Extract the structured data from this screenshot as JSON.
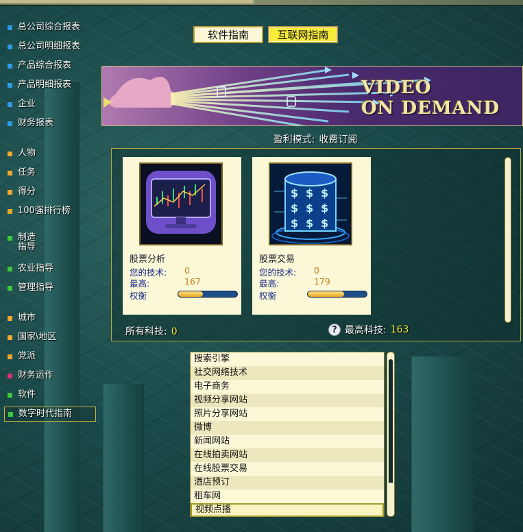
{
  "sidebar": {
    "items": [
      {
        "label": "总公司综合报表",
        "color": "#2e9be6"
      },
      {
        "label": "总公司明细报表",
        "color": "#2e9be6"
      },
      {
        "label": "产品综合报表",
        "color": "#2e9be6"
      },
      {
        "label": "产品明细报表",
        "color": "#2e9be6"
      },
      {
        "label": "企业",
        "color": "#2e9be6"
      },
      {
        "label": "财务报表",
        "color": "#2e9be6"
      },
      {
        "label": "人物",
        "color": "#f0a830"
      },
      {
        "label": "任务",
        "color": "#f0a830"
      },
      {
        "label": "得分",
        "color": "#f0a830"
      },
      {
        "label": "100强排行榜",
        "color": "#f0a830"
      },
      {
        "label": "制造\n指导",
        "color": "#3cc83c"
      },
      {
        "label": "农业指导",
        "color": "#3cc83c"
      },
      {
        "label": "管理指导",
        "color": "#3cc83c"
      },
      {
        "label": "城市",
        "color": "#f0a830"
      },
      {
        "label": "国家\\地区",
        "color": "#f0a830"
      },
      {
        "label": "党派",
        "color": "#f0a830"
      },
      {
        "label": "财务运作",
        "color": "#e0306a"
      },
      {
        "label": "软件",
        "color": "#3cc83c"
      },
      {
        "label": "数字时代指南",
        "color": "#3cc83c",
        "selected": true
      }
    ]
  },
  "guide_buttons": {
    "software": "软件指南",
    "internet": "互联网指南"
  },
  "banner": {
    "line1": "VIDEO",
    "line2": "ON DEMAND"
  },
  "profit_mode": {
    "label": "盈利模式:",
    "value": "收费订阅"
  },
  "tech_cards": [
    {
      "name": "股票分析",
      "icon": "stock-analysis-monitor-icon",
      "your_tech_label": "您的技术:",
      "your_tech": "0",
      "max_label": "最高:",
      "max": "167",
      "weight_label": "权衡",
      "weight_level": 0.42
    },
    {
      "name": "股票交易",
      "icon": "stock-trading-server-icon",
      "your_tech_label": "您的技术:",
      "your_tech": "0",
      "max_label": "最高:",
      "max": "179",
      "weight_label": "权衡",
      "weight_level": 0.62
    }
  ],
  "panel_footer": {
    "all_tech_label": "所有科技:",
    "all_tech": "0",
    "max_tech_label": "最高科技:",
    "max_tech": "163"
  },
  "topics": [
    "搜索引擎",
    "社交网络技术",
    "电子商务",
    "视频分享网站",
    "照片分享网站",
    "微博",
    "新闻网站",
    "在线拍卖网站",
    "在线股票交易",
    "酒店预订",
    "租车网",
    "视频点播"
  ],
  "selected_topic": "视频点播"
}
